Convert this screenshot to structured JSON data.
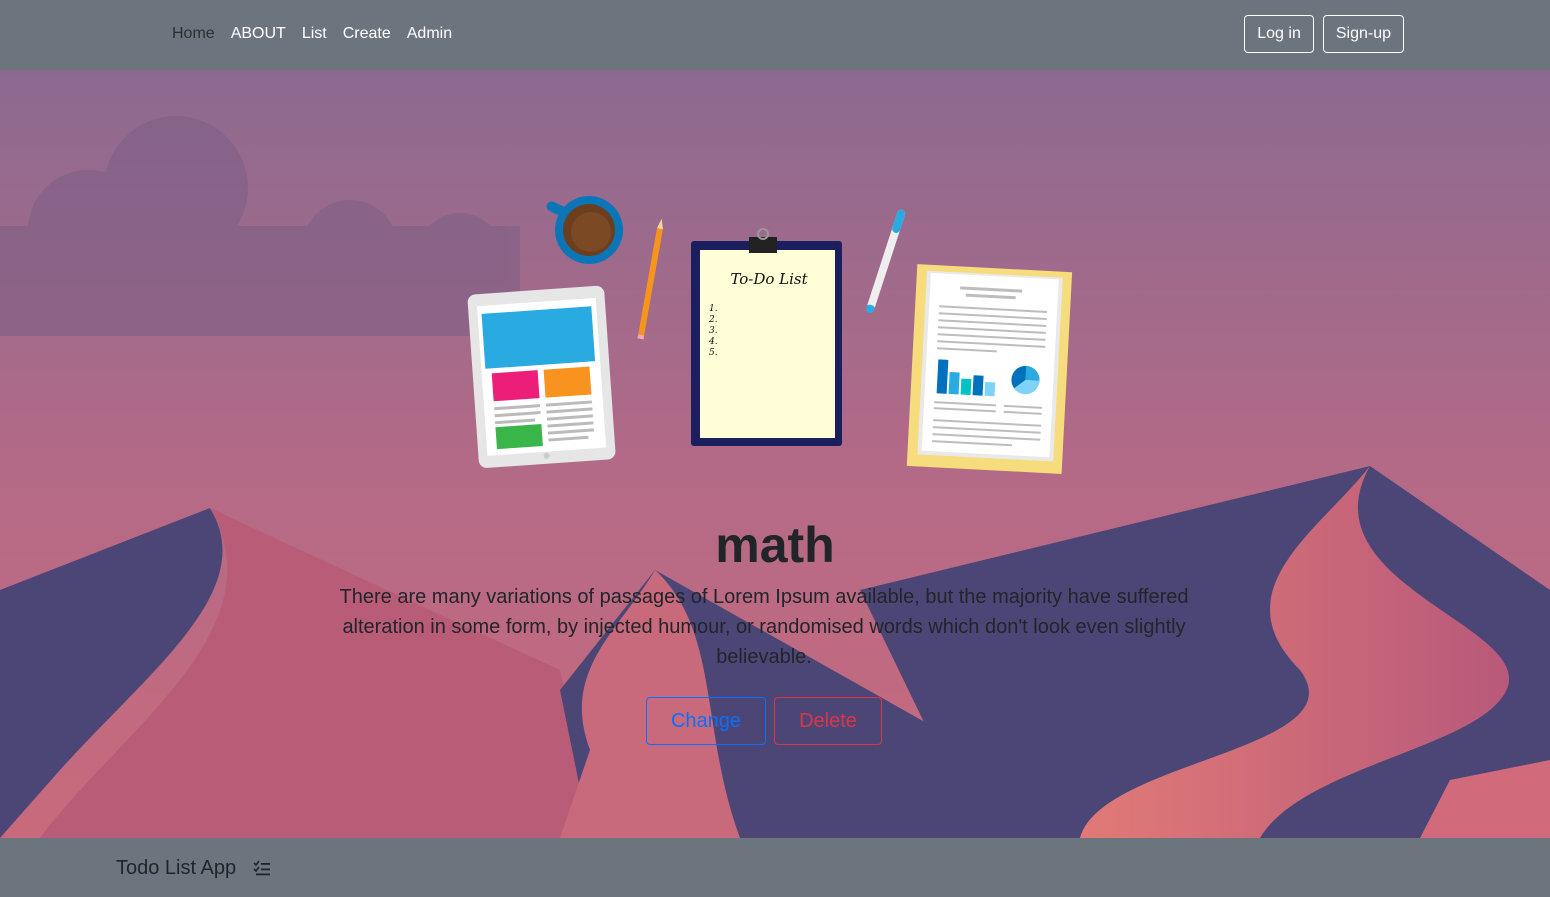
{
  "navbar": {
    "links": [
      "Home",
      "ABOUT",
      "List",
      "Create",
      "Admin"
    ],
    "active_link": "Home",
    "login_label": "Log in",
    "signup_label": "Sign-up"
  },
  "hero": {
    "clipboard_heading": "To-Do List",
    "clipboard_items": [
      "1.",
      "2.",
      "3.",
      "4.",
      "5."
    ],
    "title": "math",
    "description": "There are many variations of passages of Lorem Ipsum available, but the majority have suffered alteration in some form, by injected humour, or randomised words which don't look even slightly believable.",
    "change_label": "Change",
    "delete_label": "Delete"
  },
  "footer": {
    "brand": "Todo List App",
    "brand_icon": "list-check-icon"
  },
  "colors": {
    "navbar_bg": "#6c757d",
    "sky_top": "#8c6a90",
    "sky_bottom": "#c96a7c",
    "dune_dark": "#4c4677",
    "dune_pink": "#c25d78",
    "primary": "#0d6efd",
    "danger": "#dc3545"
  }
}
